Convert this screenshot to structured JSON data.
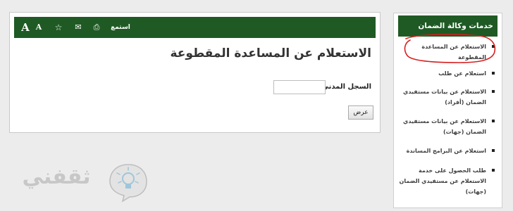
{
  "toolbar": {
    "font_large": "A",
    "font_small": "A",
    "star_icon": "☆",
    "mail_icon": "✉",
    "print_icon": "⎙",
    "listen_label": "استمع"
  },
  "main": {
    "title": "الاستعلام عن المساعدة المقطوعة",
    "civil_label": "السجل المدني",
    "required_mark": "*",
    "civil_value": "",
    "show_button": "عرض"
  },
  "sidebar": {
    "header": "خدمات وكالة الضمان",
    "items": [
      {
        "label": "الاستعلام عن المساعدة المقطوعة"
      },
      {
        "label": "استعلام عن طلب"
      },
      {
        "label": "الاستعلام عن بيانات مستفيدي الضمان (أفراد)"
      },
      {
        "label": "الاستعلام عن بيانات مستفيدي الضمان (جهات)"
      },
      {
        "label": "استعلام عن البرامج المساندة"
      },
      {
        "label": "طلب الحصول على خدمة الاستعلام عن مستفيدي الضمان (جهات)"
      }
    ]
  },
  "logo": {
    "text": "ثقفني"
  },
  "colors": {
    "brand_green": "#1f5a24",
    "annotation_red": "#d81e1e",
    "background": "#ececec"
  }
}
